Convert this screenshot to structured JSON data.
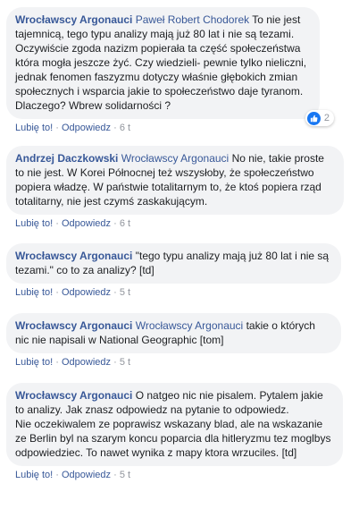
{
  "actions": {
    "like": "Lubię to!",
    "reply": "Odpowiedz",
    "dot": "·"
  },
  "colors": {
    "link": "#385898",
    "bubble": "#f2f3f5",
    "meta": "#90949c",
    "like_badge": "#1877f2"
  },
  "comments": [
    {
      "author": "Wrocławscy Argonauci",
      "tagged": "Paweł Robert Chodorek",
      "text": "To nie jest tajemnicą, tego typu analizy mają już 80 lat i nie są tezami. Oczywiście zgoda nazizm popierała ta część społeczeństwa która mogła jeszcze żyć. Czy wiedzieli- pewnie tylko nieliczni, jednak fenomen faszyzmu dotyczy właśnie głębokich zmian społecznych i wsparcia jakie to społeczeństwo daje tyranom. Dlaczego? Wbrew solidarności ?",
      "time": "6 t",
      "reaction_icon": "like-icon",
      "reaction_count": "2"
    },
    {
      "author": "Andrzej Daczkowski",
      "tagged": "Wrocławscy Argonauci",
      "text": "No nie, takie proste to nie jest. W Korei Północnej też wszysłoby, że społeczeństwo popiera władzę. W państwie totalitarnym to, że ktoś popiera rząd totalitarny, nie jest czymś zaskakującym.",
      "time": "6 t"
    },
    {
      "author": "Wrocławscy Argonauci",
      "tagged": "",
      "text": "\"tego typu analizy mają już 80 lat i nie są tezami.\" co to za analizy? [td]",
      "time": "5 t"
    },
    {
      "author": "Wrocławscy Argonauci",
      "tagged": "Wrocławscy Argonauci",
      "text": "takie o których nic nie napisali w National Geographic [tom]",
      "time": "5 t"
    },
    {
      "author": "Wrocławscy Argonauci",
      "tagged": "",
      "text": "O natgeo nic nie pisalem. Pytalem jakie to analizy. Jak znasz odpowiedz na pytanie to odpowiedz.\nNie oczekiwalem ze poprawisz wskazany blad, ale na wskazanie ze Berlin byl na szarym koncu poparcia dla hitleryzmu tez moglbys odpowiedziec. To nawet wynika z mapy ktora wrzuciles. [td]",
      "time": "5 t"
    }
  ]
}
